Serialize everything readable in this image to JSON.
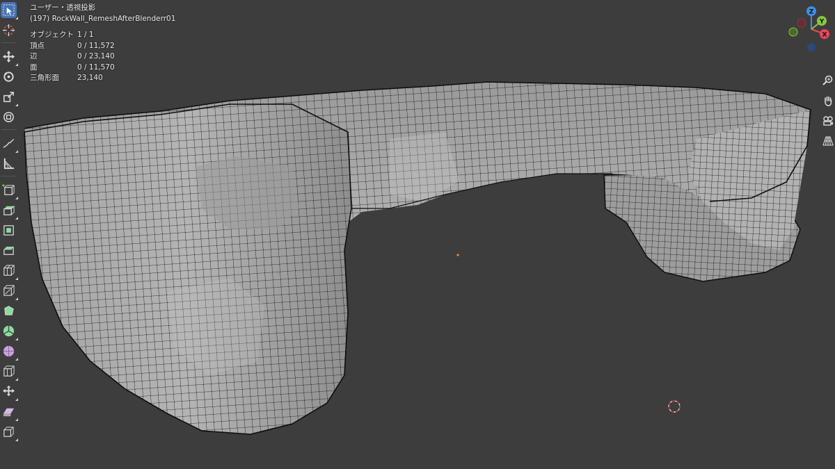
{
  "viewport": {
    "view_name": "ユーザー・透視投影",
    "object_info": "(197) RockWall_RemeshAfterBlenderr01",
    "stats": [
      {
        "label": "オブジェクト",
        "value": "1 / 1"
      },
      {
        "label": "頂点",
        "value": "0 / 11,572"
      },
      {
        "label": "辺",
        "value": "0 / 23,140"
      },
      {
        "label": "面",
        "value": "0 / 11,570"
      },
      {
        "label": "三角形面",
        "value": "23,140"
      }
    ]
  },
  "gizmo": {
    "z_label": "Z",
    "y_label": "Y",
    "x_label": "X",
    "colors": {
      "x": "#e8475b",
      "y": "#8bc53f",
      "z": "#3e8ee8"
    }
  },
  "toolbar": {
    "tools": [
      "select-box-icon",
      "cursor-icon",
      "move-icon",
      "rotate-icon",
      "scale-icon",
      "transform-icon",
      "annotate-icon",
      "measure-icon",
      "add-cube-icon",
      "extrude-icon",
      "inset-icon",
      "bevel-icon",
      "loop-cut-icon",
      "knife-icon",
      "poly-build-icon",
      "spin-icon",
      "smooth-icon",
      "edge-slide-icon",
      "shrink-fatten-icon",
      "shear-icon",
      "rip-icon"
    ]
  },
  "colors": {
    "background": "#3d3d3d",
    "mesh_face": "#a9a9a9",
    "wire": "#111111",
    "active_tool": "#4772b3"
  }
}
